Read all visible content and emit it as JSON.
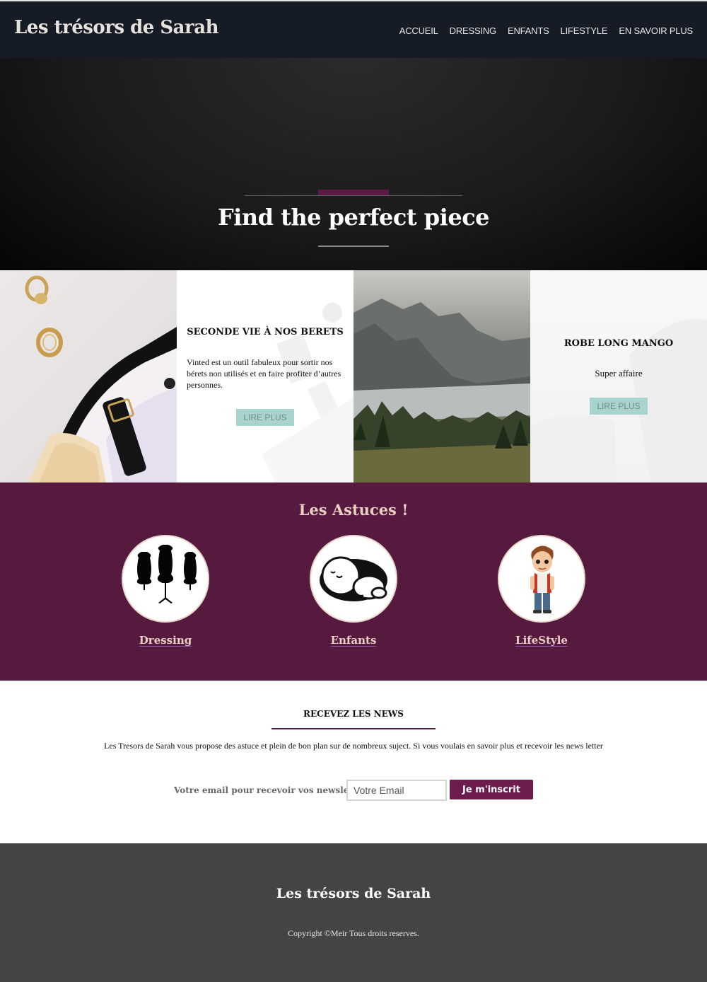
{
  "site": {
    "brand": "Les trésors de Sarah"
  },
  "nav": {
    "items": [
      "ACCUEIL",
      "DRESSING",
      "ENFANTS",
      "LIFESTYLE",
      "EN SAVOIR PLUS"
    ]
  },
  "hero": {
    "title": "Find the perfect piece"
  },
  "cards": [
    {
      "title": "SECONDE VIE À NOS BERETS",
      "text": "Vinted est un outil fabuleux pour sortir nos bérets non utilisés et en faire profiter d’autres personnes.",
      "button": "LIRE PLUS"
    },
    {
      "title": "ROBE LONG MANGO",
      "text": "Super affaire",
      "button": "LIRE PLUS"
    }
  ],
  "astuces": {
    "title": "Les Astuces !",
    "items": [
      {
        "label": "Dressing",
        "icon": "mannequin-icon"
      },
      {
        "label": "Enfants",
        "icon": "sleeping-baby-icon"
      },
      {
        "label": "LifeStyle",
        "icon": "boy-cartoon-icon"
      }
    ]
  },
  "newsletter": {
    "title": "RECEVEZ LES NEWS",
    "description": "Les Tresors de Sarah vous propose des astuce et plein de bon plan sur de nombreux suject. Si vous voulais en savoir plus et recevoir les news letter",
    "form_label": "Votre email pour recevoir vos newsletters :",
    "email_placeholder": "Votre Email",
    "submit_label": "Je m'inscrit"
  },
  "footer": {
    "brand": "Les trésors de Sarah",
    "copyright": "Copyright ©Meir Tous droits reserves."
  },
  "colors": {
    "header_bg": "#161c26",
    "accent": "#5a1b40",
    "astuces_bg": "#561a3e",
    "button_bg": "#6d1d4d",
    "read_more_bg": "#a9d3cf",
    "footer_bg": "#444444"
  }
}
